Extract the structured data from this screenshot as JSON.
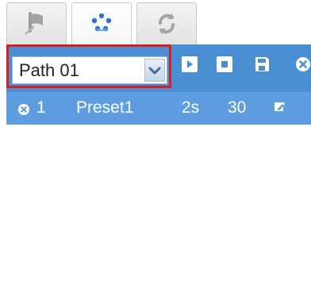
{
  "tabs": [
    {
      "id": "preset",
      "icon": "flag-icon"
    },
    {
      "id": "patrol",
      "icon": "dots-icon"
    },
    {
      "id": "pattern",
      "icon": "refresh-icon"
    }
  ],
  "toolbar": {
    "path_value": "Path 01",
    "icons": [
      "play-icon",
      "stop-icon",
      "save-icon",
      "close-icon"
    ],
    "colors": {
      "bar": "#4a8fd3",
      "highlight": "#d41f26"
    }
  },
  "row": {
    "index": "1",
    "preset": "Preset1",
    "duration": "2s",
    "speed": "30",
    "icons": [
      "close-icon",
      "edit-icon"
    ],
    "bg": "#5d9de0"
  }
}
